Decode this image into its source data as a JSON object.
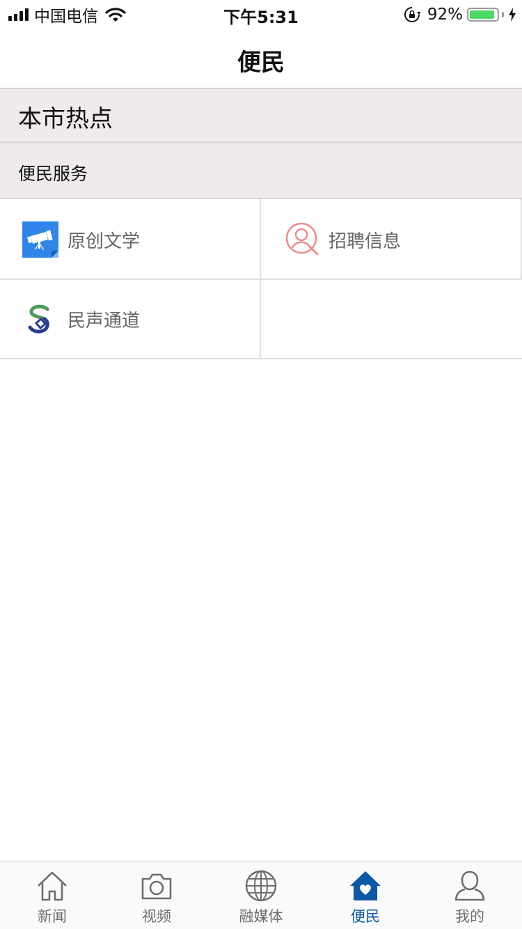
{
  "status_bar": {
    "carrier": "中国电信",
    "time": "下午5:31",
    "battery_percent": "92%",
    "battery_level": 0.92,
    "icons": [
      "signal-icon",
      "wifi-icon",
      "rotation-lock-icon",
      "battery-icon",
      "charging-bolt-icon"
    ]
  },
  "nav": {
    "title": "便民"
  },
  "hot_section": {
    "title": "本市热点"
  },
  "service_section": {
    "title": "便民服务"
  },
  "services": [
    {
      "label": "原创文学",
      "icon": "telescope-icon",
      "color": "#2f86e8"
    },
    {
      "label": "招聘信息",
      "icon": "person-search-icon",
      "color": "#f08a8a"
    },
    {
      "label": "民声通道",
      "icon": "s-logo-icon",
      "color": "#2b3d8f"
    }
  ],
  "tab_bar": {
    "active_color": "#0b58a6",
    "inactive_color": "#6d6d6d",
    "tabs": [
      {
        "label": "新闻",
        "icon": "house-outline-icon",
        "active": false
      },
      {
        "label": "视频",
        "icon": "camera-icon",
        "active": false
      },
      {
        "label": "融媒体",
        "icon": "globe-icon",
        "active": false
      },
      {
        "label": "便民",
        "icon": "house-heart-icon",
        "active": true
      },
      {
        "label": "我的",
        "icon": "user-icon",
        "active": false
      }
    ]
  }
}
